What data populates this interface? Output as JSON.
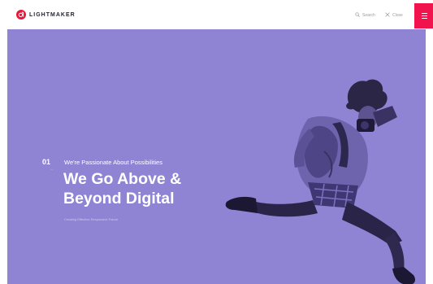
{
  "header": {
    "logo_text": "LIGHTMAKER",
    "logo_icon": "lightmaker-logo-icon",
    "search_label": "Search",
    "close_label": "Close",
    "menu_icon": "hamburger-menu-icon",
    "accent_color": "#f0134d"
  },
  "hero": {
    "index": "01",
    "eyebrow": "We're Passionate About Possibilities",
    "title_line1": "We Go Above &",
    "title_line2": "Beyond Digital",
    "caption": "Creating Effective Responsive Future",
    "background_color": "#8f84d3"
  }
}
